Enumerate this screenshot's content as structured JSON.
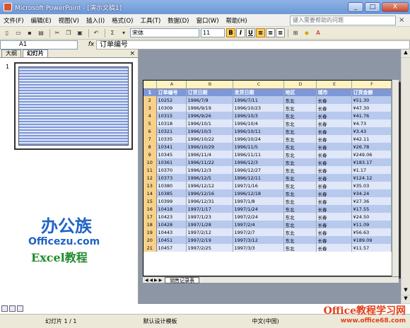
{
  "window": {
    "title": "Microsoft PowerPoint - [演示文稿1]",
    "min": "_",
    "max": "□",
    "close": "X"
  },
  "menu": {
    "items": [
      "文件(F)",
      "编辑(E)",
      "视图(V)",
      "插入(I)",
      "格式(O)",
      "工具(T)",
      "数据(D)",
      "窗口(W)",
      "帮助(H)"
    ],
    "help_placeholder": "键入需要帮助的问题"
  },
  "toolbar": {
    "font": "宋体",
    "size": "11",
    "bold": "B",
    "italic": "I",
    "underline": "U"
  },
  "formula": {
    "cell": "A1",
    "fx": "fx",
    "value": "订单编号"
  },
  "panel": {
    "tabs": [
      "大纲",
      "幻灯片"
    ],
    "slide_number": "1"
  },
  "logo": {
    "brand": "办公族",
    "url": "Officezu.com",
    "subtitle": "Excel教程"
  },
  "sheet": {
    "columns": [
      "A",
      "B",
      "C",
      "D",
      "E",
      "F"
    ],
    "header": [
      "订单编号",
      "订货日期",
      "发货日期",
      "地区",
      "城市",
      "订货金额"
    ],
    "rows": [
      [
        "10252",
        "1996/7/9",
        "1996/7/11",
        "东北",
        "长春",
        "¥51.30"
      ],
      [
        "10309",
        "1996/9/19",
        "1996/10/23",
        "东北",
        "长春",
        "¥47.30"
      ],
      [
        "10315",
        "1996/9/26",
        "1996/10/3",
        "东北",
        "长春",
        "¥41.76"
      ],
      [
        "10318",
        "1996/10/1",
        "1996/10/4",
        "东北",
        "长春",
        "¥4.73"
      ],
      [
        "10321",
        "1996/10/3",
        "1996/10/11",
        "东北",
        "长春",
        "¥3.43"
      ],
      [
        "10335",
        "1996/10/22",
        "1996/10/24",
        "东北",
        "长春",
        "¥42.11"
      ],
      [
        "10341",
        "1996/10/29",
        "1996/11/5",
        "东北",
        "长春",
        "¥26.78"
      ],
      [
        "10345",
        "1996/11/4",
        "1996/11/11",
        "东北",
        "长春",
        "¥249.06"
      ],
      [
        "10361",
        "1996/11/22",
        "1996/12/3",
        "东北",
        "长春",
        "¥183.17"
      ],
      [
        "10370",
        "1996/12/3",
        "1996/12/27",
        "东北",
        "长春",
        "¥1.17"
      ],
      [
        "10373",
        "1996/12/5",
        "1996/12/11",
        "东北",
        "长春",
        "¥124.12"
      ],
      [
        "10380",
        "1996/12/12",
        "1997/1/16",
        "东北",
        "长春",
        "¥35.03"
      ],
      [
        "10385",
        "1996/12/16",
        "1996/12/18",
        "东北",
        "长春",
        "¥34.24"
      ],
      [
        "10399",
        "1996/12/31",
        "1997/1/8",
        "东北",
        "长春",
        "¥27.36"
      ],
      [
        "10418",
        "1997/1/17",
        "1997/1/24",
        "东北",
        "长春",
        "¥17.55"
      ],
      [
        "10423",
        "1997/1/23",
        "1997/2/24",
        "东北",
        "长春",
        "¥24.50"
      ],
      [
        "10428",
        "1997/1/28",
        "1997/2/4",
        "东北",
        "长春",
        "¥11.09"
      ],
      [
        "10443",
        "1997/2/12",
        "1997/2/7",
        "东北",
        "长春",
        "¥56.63"
      ],
      [
        "10451",
        "1997/2/19",
        "1997/3/12",
        "东北",
        "长春",
        "¥189.09"
      ],
      [
        "10457",
        "1997/2/25",
        "1997/3/3",
        "东北",
        "长春",
        "¥11.57"
      ]
    ],
    "tab_name": "销售记录表"
  },
  "status": {
    "slide": "幻灯片 1 / 1",
    "template": "默认设计模板",
    "lang": "中文(中国)"
  },
  "watermark": {
    "text": "Office教程学习网",
    "url": "www.office68.com"
  }
}
